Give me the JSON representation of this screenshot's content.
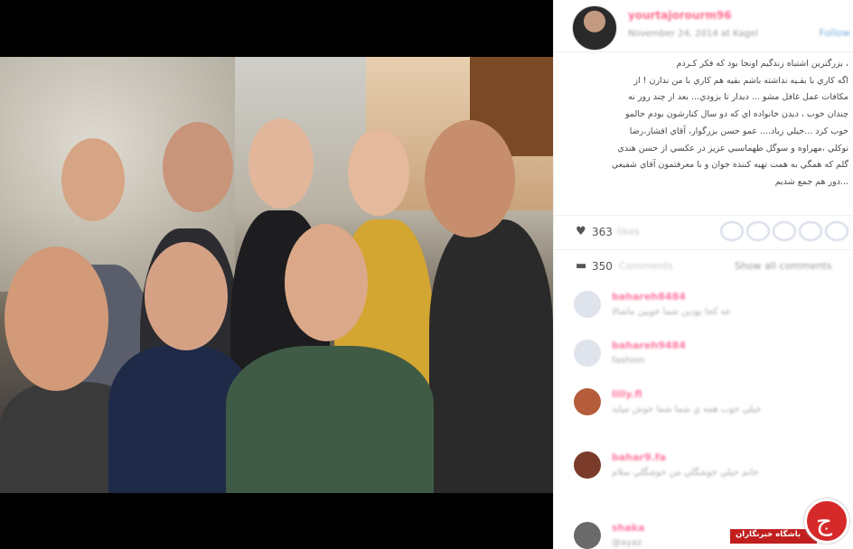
{
  "post": {
    "username": "yourtajorourm96",
    "date": "November 24, 2014 at Kagel",
    "follow_label": "Follow",
    "caption_lines": [
      "، بزرگترين اشتباه زندگيم اونجا بود که فکر کـردم",
      "اگه کاري با بقـيه نداشته باشم بقيه هم کاري با من ندارن ! از",
      "مکافات عمل غافل مشو ... ديدار تا بزودي... بعد از چند روز نه",
      "چندان خوب ، ديدن خانواده اي که دو سال کنارشون بودم حالمو",
      "خوب کرد ...خيلي زياد.... عمو حسن بزرگوار، آقاي افشار،رضا",
      "توکلي ،مهراوه و سوگل طهماسبي عزيز در عکسي از حسن هندي",
      "گلم که همگي به همت تهيه کننده جوان و با معرفتمون آقاي شفيعي",
      "...دور هم جمع شديم"
    ],
    "likes_count": "363",
    "likes_label": "likes",
    "comments_count": "350",
    "comments_label": "Comments",
    "show_all_label": "Show all comments"
  },
  "comments": [
    {
      "name": "bahareh8484",
      "text": "عه کجا بودين شما خوبين ماشالا",
      "avatar_color": "#dfe3ec"
    },
    {
      "name": "bahareh9484",
      "text": "fashion",
      "avatar_color": "#dfe3ec"
    },
    {
      "name": "lilly.fl",
      "text": "خيلي خوب همه ي شما شما خوش ميايد",
      "avatar_color": "#b55d3b"
    },
    {
      "name": "bahar9.fa",
      "text": "خانم خيلي خوشگلي من خوشگلي سلام",
      "avatar_color": "#7a3b2a"
    },
    {
      "name": "shaka",
      "text": "@ayaz",
      "avatar_color": "#6a6a6a"
    }
  ],
  "watermark": {
    "text": "باشگاه خبرنگاران",
    "glyph": "ج"
  },
  "colors": {
    "username": "#ff6d91",
    "accent_red": "#d62a2a"
  }
}
